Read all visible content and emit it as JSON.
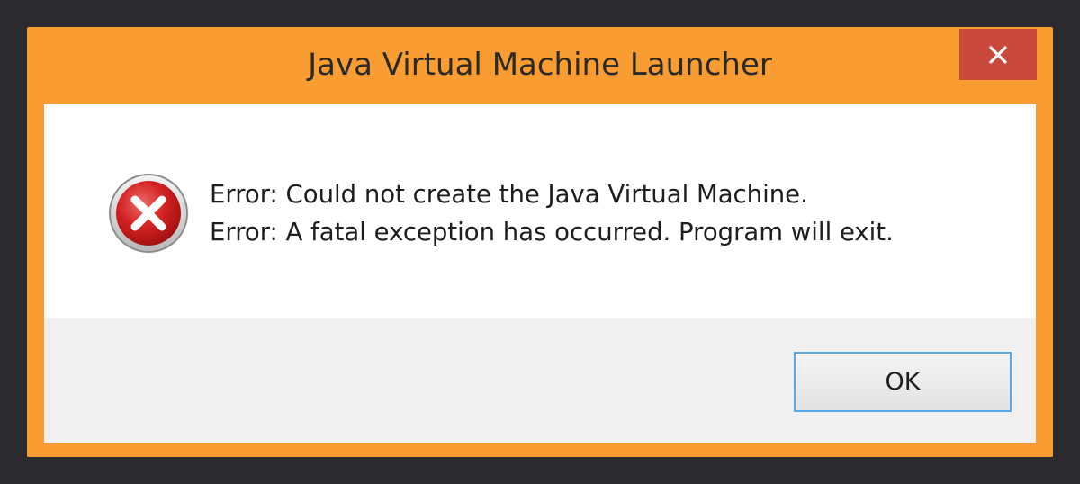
{
  "window": {
    "title": "Java Virtual Machine Launcher",
    "frame_color": "#f99d32",
    "close_button_color": "#c9493d"
  },
  "dialog": {
    "icon": "error-icon",
    "messages": [
      "Error: Could not create the Java Virtual Machine.",
      "Error: A fatal exception has occurred. Program will exit."
    ],
    "ok_label": "OK"
  }
}
